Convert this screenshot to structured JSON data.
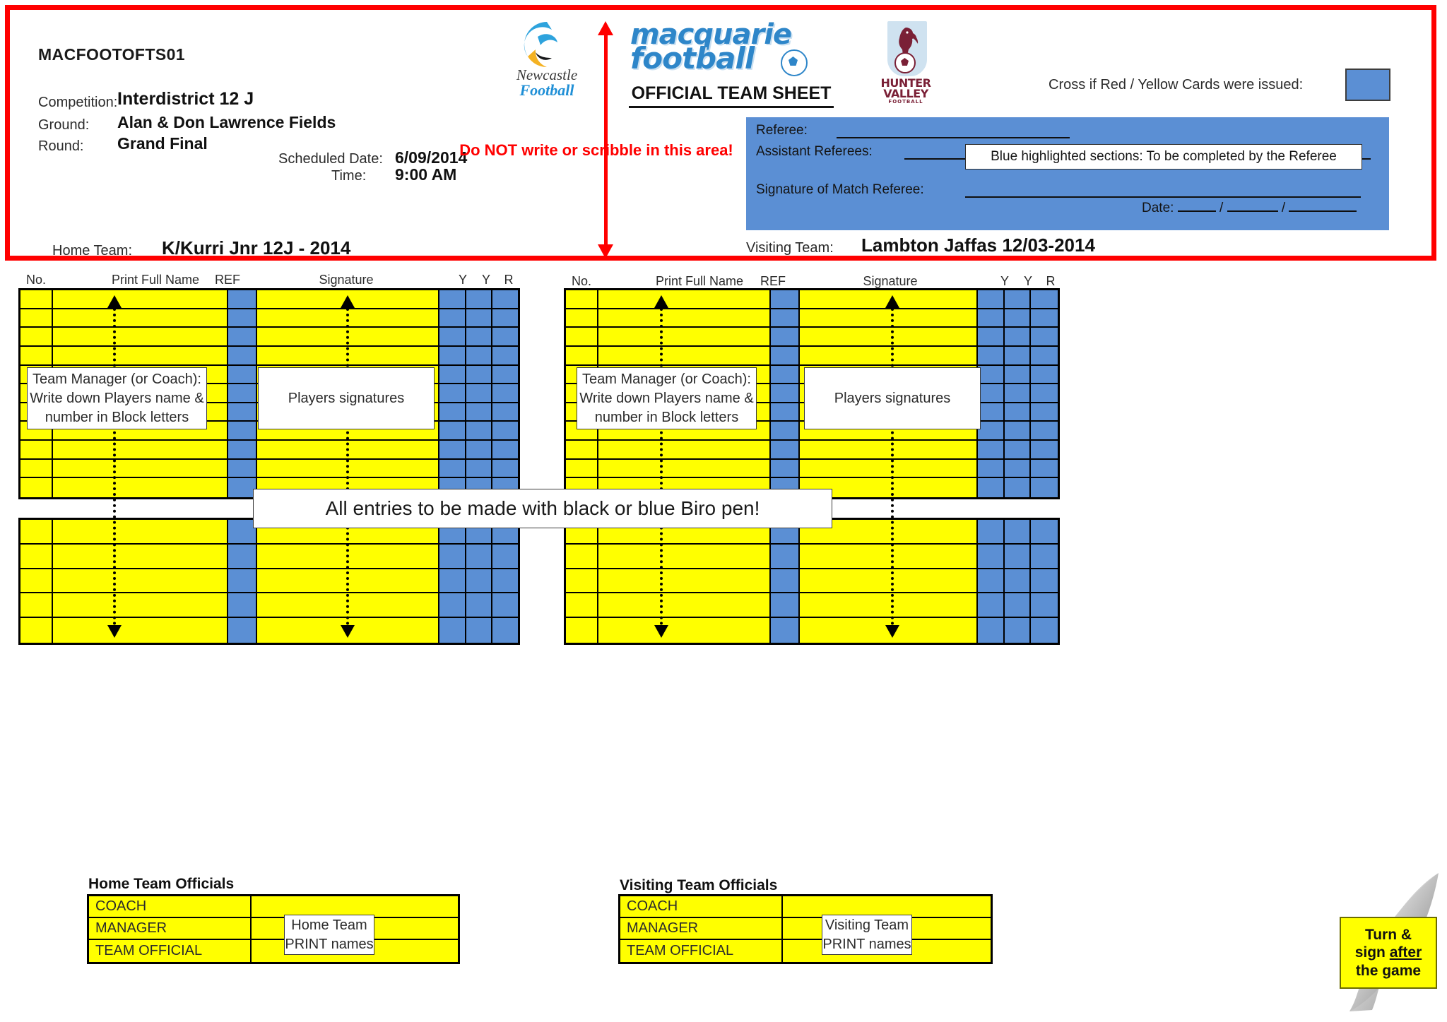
{
  "document": {
    "code": "MACFOOTOFTS01",
    "title": "OFFICIAL TEAM SHEET"
  },
  "logos": {
    "newcastle_line1": "Newcastle",
    "newcastle_line2": "Football",
    "macquarie_line1": "macquarie",
    "macquarie_line2": "football",
    "hunter_line1": "HUNTER",
    "hunter_line2": "VALLEY",
    "hunter_line3": "FOOTBALL"
  },
  "match": {
    "competition_label": "Competition:",
    "competition_value": "Interdistrict 12 J",
    "ground_label": "Ground:",
    "ground_value": "Alan & Don Lawrence Fields",
    "round_label": "Round:",
    "round_value": "Grand Final",
    "scheduled_date_label": "Scheduled Date:",
    "scheduled_date_value": "6/09/2014",
    "time_label": "Time:",
    "time_value": "9:00 AM",
    "home_team_label": "Home Team:",
    "home_team_value": "K/Kurri Jnr 12J - 2014",
    "visiting_team_label": "Visiting Team:",
    "visiting_team_value": "Lambton Jaffas 12/03-2014"
  },
  "warnings": {
    "do_not_write": "Do NOT write or scribble in this area!",
    "all_entries_banner": "All entries to be made with black or blue Biro pen!",
    "blue_sections_note": "Blue highlighted sections: To be completed by the Referee"
  },
  "cards": {
    "label": "Cross if Red / Yellow Cards were issued:"
  },
  "referee_panel": {
    "referee_label": "Referee:",
    "assistant_referees_label": "Assistant Referees:",
    "signature_label": "Signature of Match Referee:",
    "date_label": "Date:",
    "date_separator_1": "/",
    "date_separator_2": "/"
  },
  "player_table": {
    "headers": {
      "no": "No.",
      "print_full_name": "Print Full Name",
      "ref": "REF",
      "signature": "Signature",
      "y1": "Y",
      "y2": "Y",
      "r": "R"
    },
    "main_rows": 11,
    "sub_rows": 5
  },
  "callouts": {
    "manager_note": "Team Manager (or Coach):\nWrite down Players name &\nnumber in Block letters",
    "manager_note_l1": "Team Manager (or Coach):",
    "manager_note_l2": "Write down Players name &",
    "manager_note_l3": "number in Block letters",
    "players_signatures": "Players signatures",
    "home_print_l1": "Home Team",
    "home_print_l2": "PRINT names",
    "visiting_print_l1": "Visiting Team",
    "visiting_print_l2": "PRINT names"
  },
  "officials": {
    "home_title": "Home Team Officials",
    "visiting_title": "Visiting Team Officials",
    "roles": [
      "COACH",
      "MANAGER",
      "TEAM OFFICIAL"
    ]
  },
  "page_curl": {
    "line1": "Turn &",
    "line2_pre": "sign ",
    "line2_u": "after",
    "line3": "the game"
  },
  "colors": {
    "yellow": "#ffff00",
    "blue": "#5b8fd4",
    "red": "#ff0000",
    "brand_blue": "#2e86c9",
    "maroon": "#7a2036"
  }
}
